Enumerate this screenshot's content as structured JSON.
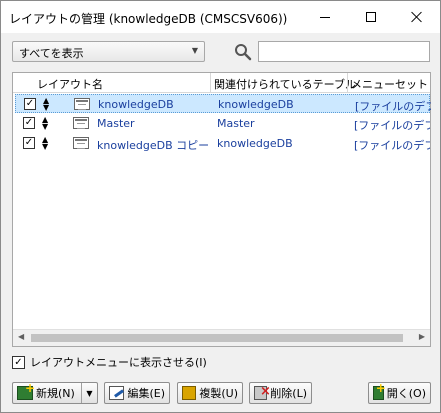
{
  "window": {
    "title": "レイアウトの管理 (knowledgeDB (CMSCSV606))"
  },
  "filter": {
    "selected": "すべてを表示",
    "search_value": ""
  },
  "list": {
    "columns": [
      "レイアウト名",
      "関連付けられているテーブル",
      "メニューセット"
    ],
    "rows": [
      {
        "checked": true,
        "name": "knowledgeDB",
        "table": "knowledgeDB",
        "menuset": "[ファイルのデフォ",
        "selected": true
      },
      {
        "checked": true,
        "name": "Master",
        "table": "Master",
        "menuset": "[ファイルのデフォ",
        "selected": false
      },
      {
        "checked": true,
        "name": "knowledgeDB コピー",
        "table": "knowledgeDB",
        "menuset": "[ファイルのデフォ",
        "selected": false
      }
    ]
  },
  "options": {
    "show_in_menu_label": "レイアウトメニューに表示させる(I)",
    "show_in_menu_checked": true
  },
  "buttons": {
    "new_label": "新規(N)",
    "edit_label": "編集(E)",
    "duplicate_label": "複製(U)",
    "delete_label": "削除(L)",
    "open_label": "開く(O)"
  },
  "icons": {
    "search": "search-icon",
    "minimize": "minimize-icon",
    "maximize": "maximize-icon",
    "close": "close-icon"
  }
}
